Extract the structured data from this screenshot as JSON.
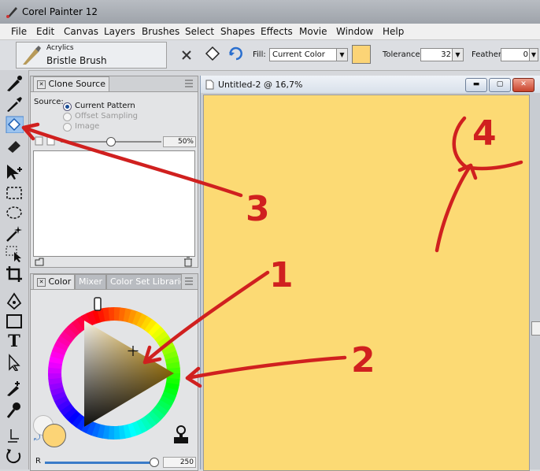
{
  "app": {
    "title": "Corel Painter 12"
  },
  "menu": [
    "File",
    "Edit",
    "Canvas",
    "Layers",
    "Brushes",
    "Select",
    "Shapes",
    "Effects",
    "Movie",
    "Window",
    "Help"
  ],
  "brush": {
    "category": "Acrylics",
    "variant": "Bristle Brush"
  },
  "propbar": {
    "fill_label": "Fill:",
    "fill_value": "Current Color",
    "tolerance_label": "Tolerance:",
    "tolerance_value": "32",
    "feather_label": "Feather:",
    "feather_value": "0"
  },
  "clone_panel": {
    "title": "Clone Source",
    "source_label": "Source:",
    "options": [
      "Current Pattern",
      "Offset Sampling",
      "Image"
    ],
    "selected_option": "Current Pattern",
    "opacity": "50%"
  },
  "color_panel": {
    "tabs": [
      "Color",
      "Mixer",
      "Color Set Libraries"
    ],
    "channel_label": "R",
    "channel_value": "250"
  },
  "document": {
    "title": "Untitled-2 @ 16,7%"
  },
  "annotations": [
    "1",
    "2",
    "3",
    "4"
  ],
  "colors": {
    "canvas_fill": "#fcda74",
    "current_color": "#fcd476",
    "annotation_red": "#d0201f"
  }
}
